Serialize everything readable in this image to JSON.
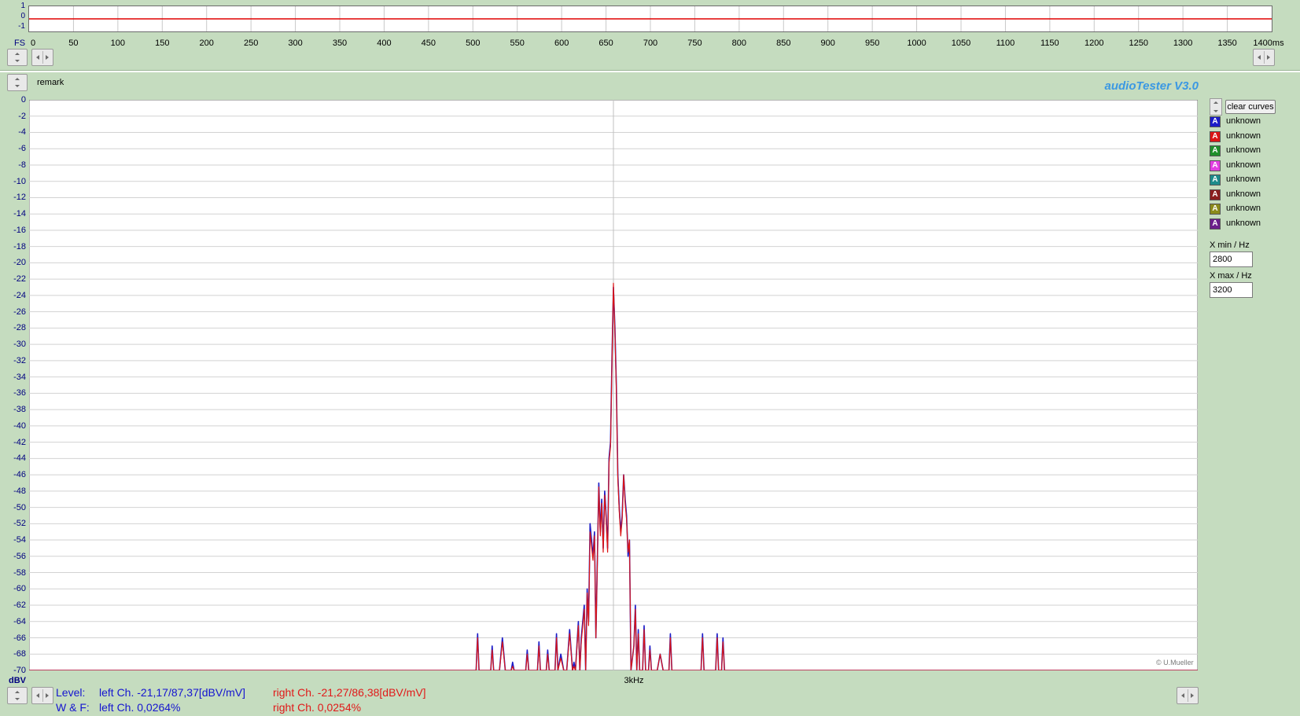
{
  "top_plot": {
    "y_labels": [
      "1",
      "0",
      "-1"
    ],
    "x_prefix": "FS",
    "x_labels": [
      "0",
      "50",
      "100",
      "150",
      "200",
      "250",
      "300",
      "350",
      "400",
      "450",
      "500",
      "550",
      "600",
      "650",
      "700",
      "750",
      "800",
      "850",
      "900",
      "950",
      "1000",
      "1050",
      "1100",
      "1150",
      "1200",
      "1250",
      "1300",
      "1350",
      "1400ms"
    ],
    "trace_color": "#e00000"
  },
  "remark": "remark",
  "brand": "audioTester  V3.0",
  "chart_data": {
    "type": "line",
    "title": "",
    "xlabel": "3kHz",
    "ylabel": "dBV",
    "xlim": [
      2800,
      3200
    ],
    "ylim": [
      -70,
      0
    ],
    "y_ticks": [
      "0",
      "-2",
      "-4",
      "-6",
      "-8",
      "-10",
      "-12",
      "-14",
      "-16",
      "-18",
      "-20",
      "-22",
      "-24",
      "-26",
      "-28",
      "-30",
      "-32",
      "-34",
      "-36",
      "-38",
      "-40",
      "-42",
      "-44",
      "-46",
      "-48",
      "-50",
      "-52",
      "-54",
      "-56",
      "-58",
      "-60",
      "-62",
      "-64",
      "-66",
      "-68",
      "-70"
    ],
    "grid": true,
    "series": [
      {
        "color": "#1c1cc8",
        "x": [
          2953,
          2953.5,
          2954,
          2958,
          2958.5,
          2959,
          2961,
          2962,
          2963,
          2965,
          2965.5,
          2966,
          2970,
          2970.5,
          2971,
          2974,
          2974.5,
          2975,
          2977,
          2977.5,
          2978,
          2980,
          2980.5,
          2981,
          2982,
          2983,
          2984,
          2985,
          2986,
          2986.5,
          2987,
          2988,
          2988.5,
          2989,
          2990,
          2990.5,
          2991,
          2991.5,
          2992,
          2993,
          2993.5,
          2994,
          2995,
          2995.5,
          2996,
          2996.5,
          2997,
          2997.5,
          2998,
          2998.5,
          2999,
          2999.5,
          3000,
          3000.5,
          3001,
          3001.5,
          3002,
          3002.5,
          3003,
          3003.5,
          3004,
          3004.5,
          3005,
          3005.5,
          3006,
          3007,
          3007.5,
          3008,
          3008.5,
          3009,
          3010,
          3010.5,
          3011,
          3012,
          3012.5,
          3013,
          3014,
          3015,
          3016,
          3017,
          3019,
          3019.5,
          3020,
          3021,
          3022,
          3023,
          3024,
          3025,
          3026,
          3030,
          3030.5,
          3031,
          3035,
          3035.5,
          3036,
          3037,
          3037.5,
          3038,
          3045
        ],
        "values": [
          -70,
          -65.5,
          -70,
          -70,
          -67,
          -70,
          -70,
          -66,
          -70,
          -70,
          -69,
          -70,
          -70,
          -67.5,
          -70,
          -70,
          -66.5,
          -70,
          -70,
          -67.5,
          -70,
          -70,
          -65.5,
          -70,
          -68,
          -70,
          -70,
          -65,
          -70,
          -69,
          -70,
          -64,
          -70,
          -66,
          -62,
          -70,
          -60,
          -64,
          -52,
          -56,
          -53,
          -66,
          -47,
          -53,
          -49,
          -55,
          -48,
          -51,
          -55,
          -44,
          -42,
          -32,
          -23,
          -28,
          -35,
          -46,
          -50,
          -53,
          -51,
          -46,
          -49,
          -51,
          -56,
          -54,
          -70,
          -67,
          -62,
          -70,
          -65,
          -70,
          -70,
          -64.5,
          -70,
          -70,
          -67,
          -70,
          -70,
          -70,
          -68,
          -70,
          -70,
          -65.5,
          -70,
          -70,
          -70,
          -70,
          -70,
          -70,
          -70,
          -70,
          -65.5,
          -70,
          -70,
          -65.5,
          -70,
          -70,
          -66,
          -70,
          -70
        ]
      },
      {
        "color": "#dc1414",
        "x": [
          2953,
          2953.5,
          2954,
          2958,
          2958.5,
          2959,
          2961,
          2962,
          2963,
          2965,
          2965.5,
          2966,
          2970,
          2970.5,
          2971,
          2974,
          2974.5,
          2975,
          2977,
          2977.5,
          2978,
          2980,
          2980.5,
          2981,
          2982,
          2983,
          2984,
          2985,
          2986,
          2986.5,
          2987,
          2988,
          2988.5,
          2989,
          2990,
          2990.5,
          2991,
          2991.5,
          2992,
          2993,
          2993.5,
          2994,
          2995,
          2995.5,
          2996,
          2996.5,
          2997,
          2997.5,
          2998,
          2998.5,
          2999,
          2999.5,
          3000,
          3000.5,
          3001,
          3001.5,
          3002,
          3002.5,
          3003,
          3003.5,
          3004,
          3004.5,
          3005,
          3005.5,
          3006,
          3007,
          3007.5,
          3008,
          3008.5,
          3009,
          3010,
          3010.5,
          3011,
          3012,
          3012.5,
          3013,
          3014,
          3015,
          3016,
          3017,
          3019,
          3019.5,
          3020,
          3021,
          3022,
          3023,
          3024,
          3025,
          3026,
          3030,
          3030.5,
          3031,
          3035,
          3035.5,
          3036,
          3037,
          3037.5,
          3038,
          3045
        ],
        "values": [
          -70,
          -66,
          -70,
          -70,
          -67.5,
          -70,
          -70,
          -66.5,
          -70,
          -70,
          -69.5,
          -70,
          -70,
          -68,
          -70,
          -70,
          -67,
          -70,
          -70,
          -68,
          -70,
          -70,
          -66,
          -70,
          -68.5,
          -70,
          -70,
          -65.5,
          -70,
          -69.5,
          -70,
          -64.5,
          -70,
          -66.5,
          -62.5,
          -70,
          -60.5,
          -64.5,
          -53,
          -56.5,
          -53.5,
          -66,
          -47.5,
          -53.5,
          -49.5,
          -55.5,
          -48.5,
          -51.5,
          -55.5,
          -44.5,
          -42.5,
          -32.5,
          -22.5,
          -28.5,
          -35.5,
          -46.5,
          -50.5,
          -53.5,
          -51.5,
          -46,
          -49.5,
          -51.5,
          -55.5,
          -54,
          -70,
          -67,
          -62.5,
          -70,
          -65.5,
          -70,
          -70,
          -65,
          -70,
          -70,
          -67.5,
          -70,
          -70,
          -70,
          -68,
          -70,
          -70,
          -66,
          -70,
          -70,
          -70,
          -70,
          -70,
          -70,
          -70,
          -70,
          -66,
          -70,
          -70,
          -66,
          -70,
          -70,
          -66.5,
          -70,
          -70
        ]
      }
    ]
  },
  "copyright": "© U.Mueller",
  "clear_curves": "clear curves",
  "legend": [
    {
      "icon": "A",
      "label": "unknown",
      "color": "#1c1cc8"
    },
    {
      "icon": "A",
      "label": "unknown",
      "color": "#dc1414"
    },
    {
      "icon": "A",
      "label": "unknown",
      "color": "#1f8f2a"
    },
    {
      "icon": "A",
      "label": "unknown",
      "color": "#e23fe2"
    },
    {
      "icon": "A",
      "label": "unknown",
      "color": "#1b8b8b"
    },
    {
      "icon": "A",
      "label": "unknown",
      "color": "#8b1e1e"
    },
    {
      "icon": "A",
      "label": "unknown",
      "color": "#8b8b1b"
    },
    {
      "icon": "A",
      "label": "unknown",
      "color": "#6b1e8b"
    }
  ],
  "x_min": {
    "label": "X min / Hz",
    "value": "2800"
  },
  "x_max": {
    "label": "X max / Hz",
    "value": "3200"
  },
  "readout": {
    "level_label": "Level:",
    "level_left": "left Ch. -21,17/87,37[dBV/mV]",
    "level_right": "right Ch. -21,27/86,38[dBV/mV]",
    "wf_label": "W & F:",
    "wf_left": "left Ch. 0,0264%",
    "wf_right": "right Ch. 0,0254%"
  }
}
